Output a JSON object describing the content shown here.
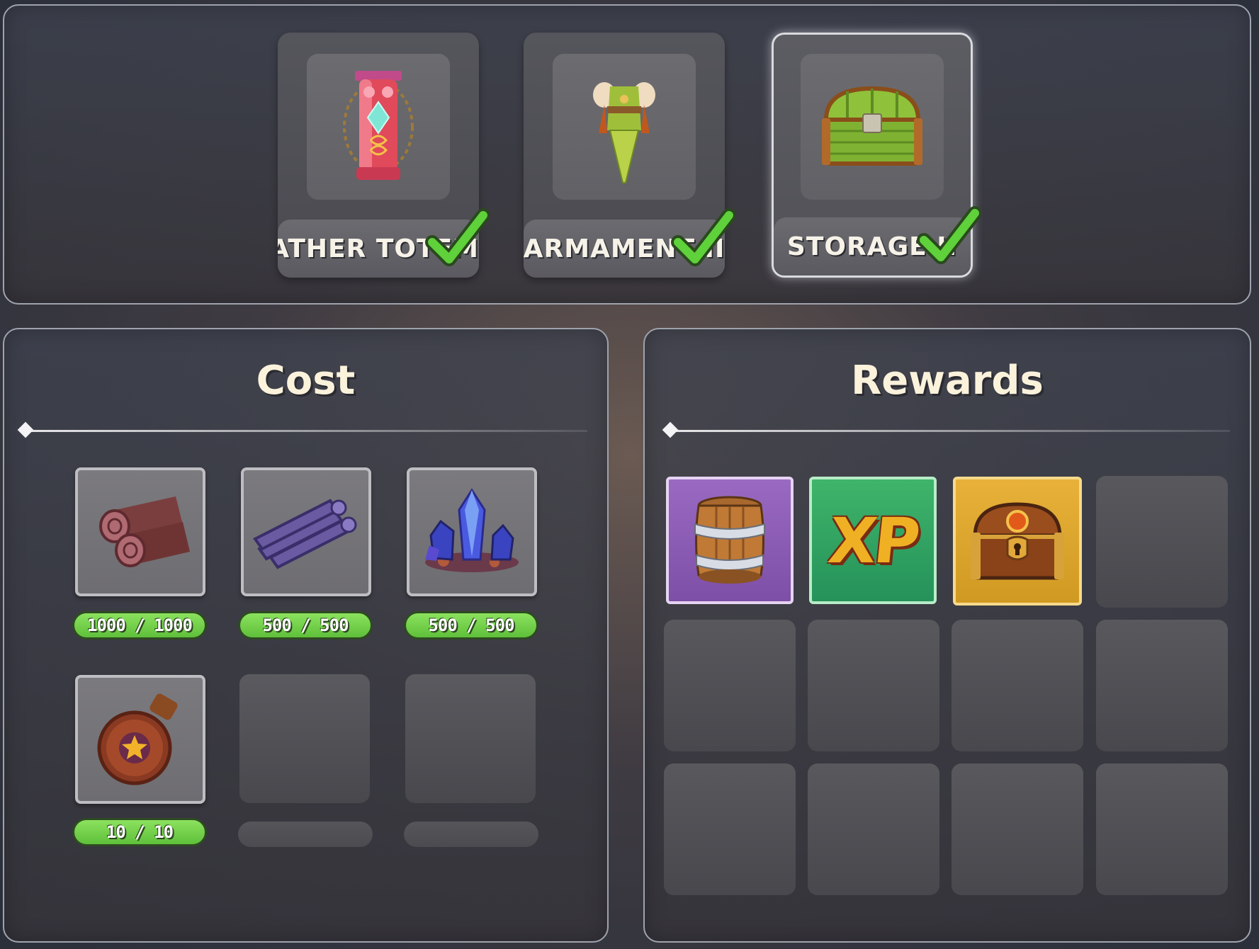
{
  "upgrades": [
    {
      "label": "GATHER TOTEM II",
      "icon": "totem-icon",
      "completed": true
    },
    {
      "label": "ARMAMENT II",
      "icon": "armor-icon",
      "completed": true
    },
    {
      "label": "STORAGE II",
      "icon": "storage-chest-icon",
      "completed": true,
      "selected": true
    }
  ],
  "cost": {
    "title": "Cost",
    "items": [
      {
        "icon": "wood-logs-icon",
        "amount": "1000 / 1000"
      },
      {
        "icon": "purple-planks-icon",
        "amount": "500 / 500"
      },
      {
        "icon": "blue-crystal-icon",
        "amount": "500 / 500"
      },
      {
        "icon": "potion-flask-icon",
        "amount": "10 / 10"
      }
    ]
  },
  "rewards": {
    "title": "Rewards",
    "items": [
      {
        "icon": "barrel-icon",
        "rarity_color": "#8a5bb4"
      },
      {
        "icon": "xp-icon",
        "text": "XP",
        "rarity_color": "#2fa462"
      },
      {
        "icon": "treasure-chest-icon",
        "rarity_color": "#dfa62e"
      }
    ]
  },
  "colors": {
    "progress_fill": "#6fd14a",
    "check": "#5fd13a",
    "title_text": "#fbf2dc"
  }
}
